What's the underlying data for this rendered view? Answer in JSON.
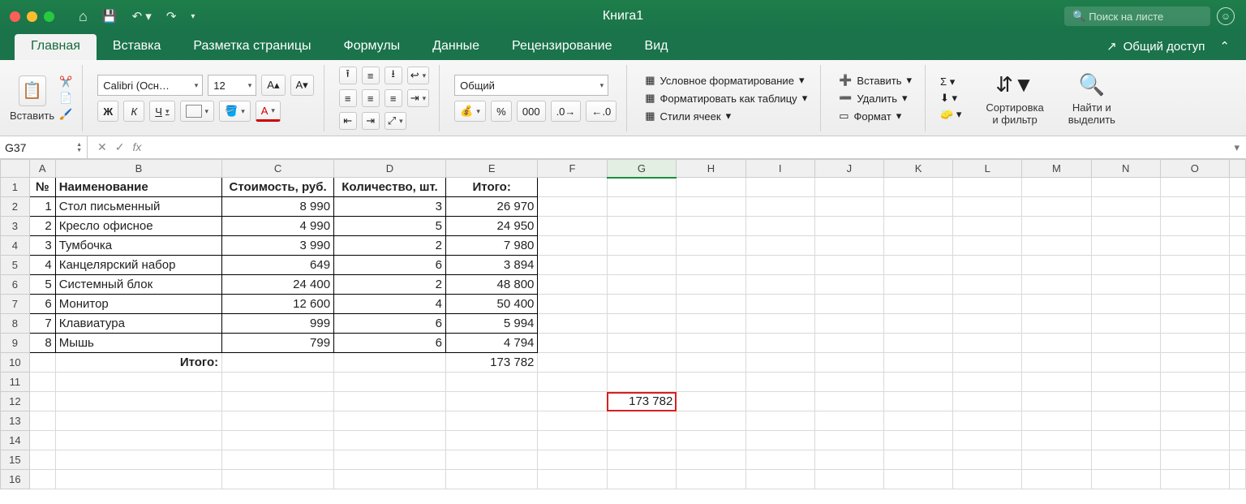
{
  "window": {
    "title": "Книга1"
  },
  "search": {
    "placeholder": "Поиск на листе"
  },
  "tabs": [
    "Главная",
    "Вставка",
    "Разметка страницы",
    "Формулы",
    "Данные",
    "Рецензирование",
    "Вид"
  ],
  "share": "Общий доступ",
  "ribbon": {
    "paste": "Вставить",
    "font_name": "Calibri (Осн…",
    "font_size": "12",
    "bold": "Ж",
    "italic": "К",
    "underline": "Ч",
    "number_format": "Общий",
    "percent": "%",
    "thousands": "000",
    "cond_format": "Условное форматирование",
    "format_table": "Форматировать как таблицу",
    "cell_styles": "Стили ячеек",
    "insert": "Вставить",
    "delete": "Удалить",
    "format": "Формат",
    "sort_filter": "Сортировка\nи фильтр",
    "find_select": "Найти и\nвыделить"
  },
  "namebox": "G37",
  "fx": "fx",
  "columns": [
    "A",
    "B",
    "C",
    "D",
    "E",
    "F",
    "G",
    "H",
    "I",
    "J",
    "K",
    "L",
    "M",
    "N",
    "O"
  ],
  "headers": {
    "num": "№",
    "name": "Наименование",
    "cost": "Стоимость, руб.",
    "qty": "Количество, шт.",
    "total": "Итого:"
  },
  "rows": [
    {
      "n": "1",
      "name": "Стол письменный",
      "cost": "8 990",
      "qty": "3",
      "total": "26 970"
    },
    {
      "n": "2",
      "name": "Кресло офисное",
      "cost": "4 990",
      "qty": "5",
      "total": "24 950"
    },
    {
      "n": "3",
      "name": "Тумбочка",
      "cost": "3 990",
      "qty": "2",
      "total": "7 980"
    },
    {
      "n": "4",
      "name": "Канцелярский набор",
      "cost": "649",
      "qty": "6",
      "total": "3 894"
    },
    {
      "n": "5",
      "name": "Системный блок",
      "cost": "24 400",
      "qty": "2",
      "total": "48 800"
    },
    {
      "n": "6",
      "name": "Монитор",
      "cost": "12 600",
      "qty": "4",
      "total": "50 400"
    },
    {
      "n": "7",
      "name": "Клавиатура",
      "cost": "999",
      "qty": "6",
      "total": "5 994"
    },
    {
      "n": "8",
      "name": "Мышь",
      "cost": "799",
      "qty": "6",
      "total": "4 794"
    }
  ],
  "footer": {
    "label": "Итого:",
    "grand": "173 782"
  },
  "g12": "173 782"
}
